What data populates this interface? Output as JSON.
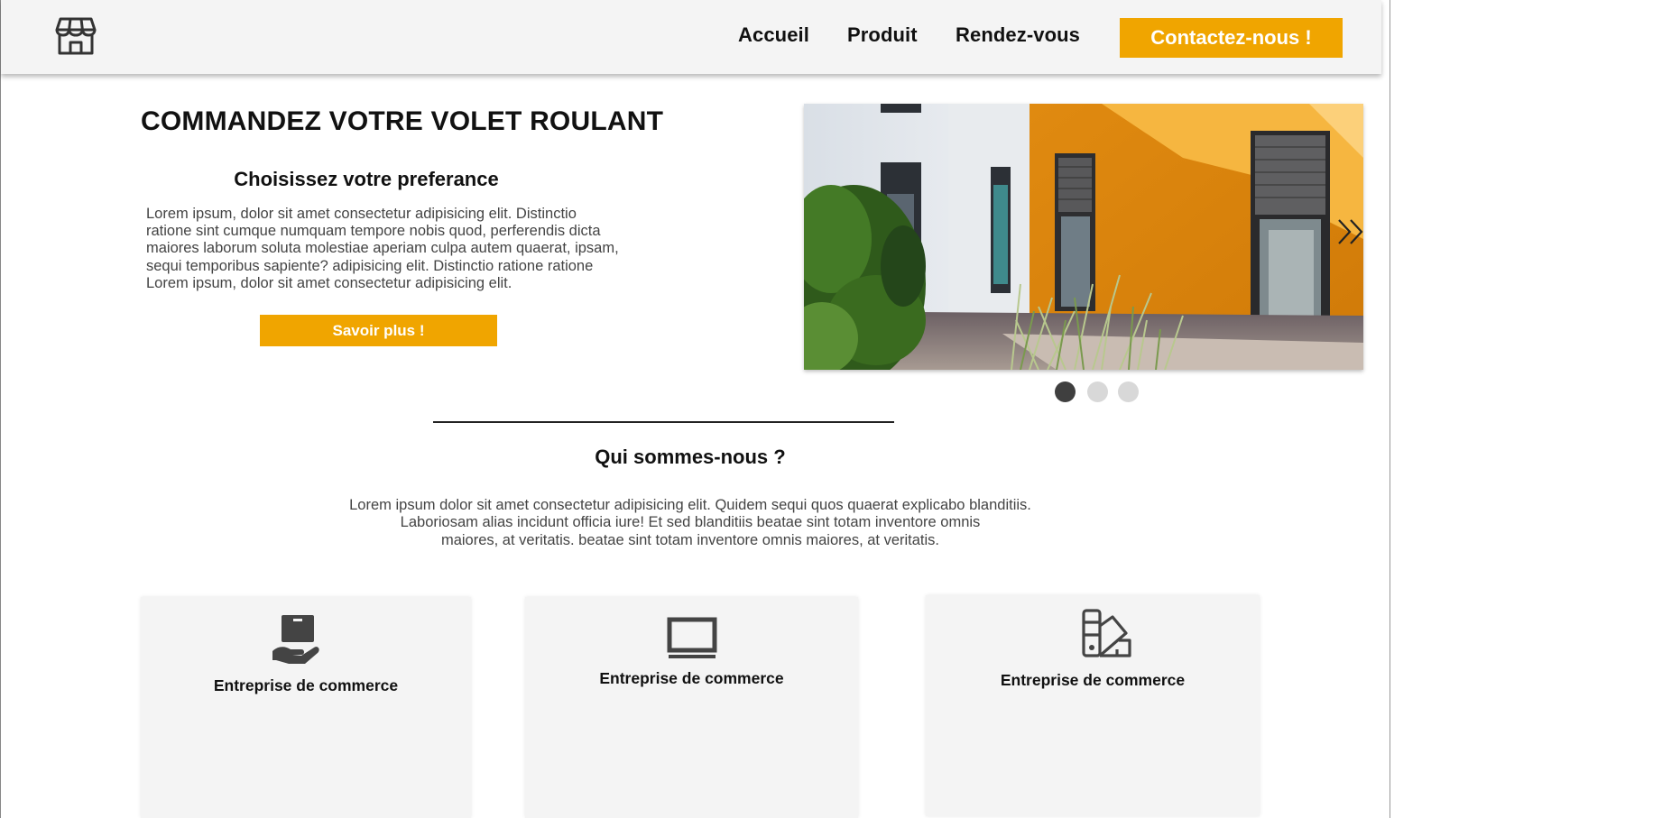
{
  "header": {
    "logo_icon": "store-icon",
    "nav": [
      {
        "label": "Accueil"
      },
      {
        "label": "Produit"
      },
      {
        "label": "Rendez-vous"
      }
    ],
    "contact_label": "Contactez-nous !"
  },
  "hero": {
    "title": "COMMANDEZ VOTRE VOLET ROULANT",
    "subtitle": "Choisissez votre preferance",
    "text": " Lorem ipsum, dolor sit amet consectetur adipisicing elit. Distinctio\nratione sint cumque numquam tempore nobis quod, perferendis dicta\nmaiores laborum soluta molestiae aperiam culpa autem quaerat, ipsam,\nsequi temporibus sapiente? adipisicing elit. Distinctio ratione  ratione\nLorem ipsum, dolor sit amet consectetur adipisicing elit.",
    "button_label": "Savoir plus !"
  },
  "carousel": {
    "image": "house-with-roller-shutters-photo",
    "next_icon": "double-chevron-right-icon",
    "dots": 3,
    "active_dot": 1
  },
  "about": {
    "title": "Qui sommes-nous ?",
    "text": "Lorem ipsum dolor sit amet consectetur adipisicing elit. Quidem sequi quos quaerat explicabo blanditiis.\nLaboriosam alias incidunt officia iure! Et sed blanditiis beatae sint totam inventore omnis\nmaiores, at veritatis. beatae sint totam inventore omnis maiores, at veritatis."
  },
  "cards": [
    {
      "icon": "hand-holding-box-icon",
      "label": "Entreprise de commerce"
    },
    {
      "icon": "monitor-icon",
      "label": "Entreprise de commerce"
    },
    {
      "icon": "swatchbook-icon",
      "label": "Entreprise de commerce"
    }
  ],
  "colors": {
    "accent": "#f0a500",
    "header_bg": "#f4f4f4",
    "card_bg": "#f4f4f4",
    "dot_active": "#3f3f3f",
    "dot_inactive": "#d8d8d8"
  }
}
